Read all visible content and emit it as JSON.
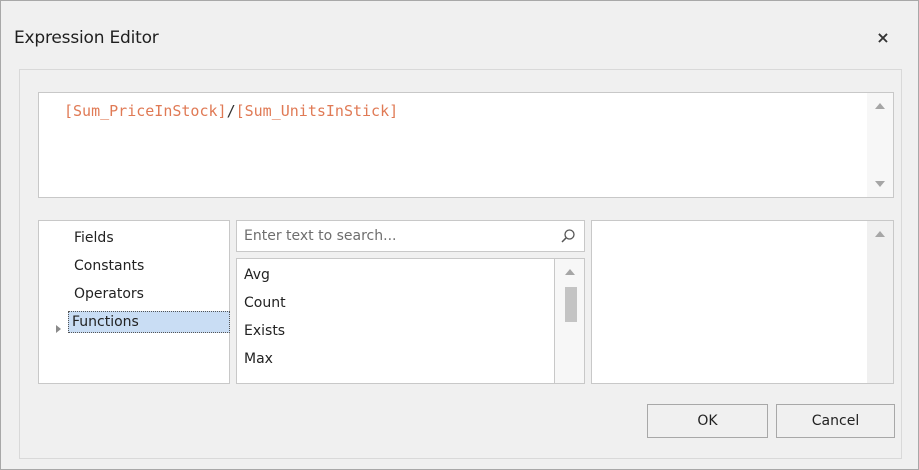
{
  "dialog": {
    "title": "Expression Editor",
    "close_glyph": "×"
  },
  "expression": {
    "field1": "[Sum_PriceInStock]",
    "operator": "/",
    "field2": "[Sum_UnitsInStick]"
  },
  "categories": [
    {
      "label": "Fields",
      "selected": false
    },
    {
      "label": "Constants",
      "selected": false
    },
    {
      "label": "Operators",
      "selected": false
    },
    {
      "label": "Functions",
      "selected": true
    }
  ],
  "search": {
    "placeholder": "Enter text to search...",
    "value": ""
  },
  "functions": [
    "Avg",
    "Count",
    "Exists",
    "Max"
  ],
  "buttons": {
    "ok": "OK",
    "cancel": "Cancel"
  },
  "colors": {
    "field_token": "#e07a55",
    "selection": "#c9ddf4"
  },
  "icons": {
    "close": "close-icon",
    "search": "search-icon",
    "expand": "chevron-right-icon"
  }
}
